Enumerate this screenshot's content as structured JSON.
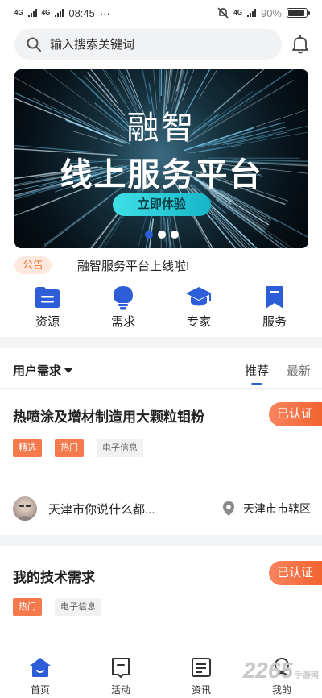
{
  "status_bar": {
    "time": "08:45",
    "dots": "···",
    "network_left": "4G",
    "network_right": "4G",
    "battery": "90%",
    "battery_level": 0.9
  },
  "search": {
    "placeholder": "输入搜索关键词"
  },
  "banner": {
    "title_line1": "融智",
    "title_line2": "线上服务平台",
    "button_label": "立即体验",
    "page_count": 3,
    "active_index": 0
  },
  "notice": {
    "tag": "公告",
    "text": "融智服务平台上线啦!"
  },
  "quick_nav": [
    {
      "label": "资源",
      "icon": "folder-icon"
    },
    {
      "label": "需求",
      "icon": "lightbulb-icon"
    },
    {
      "label": "专家",
      "icon": "graduation-cap-icon"
    },
    {
      "label": "服务",
      "icon": "bookmark-icon"
    }
  ],
  "section": {
    "filter_label": "用户需求",
    "tabs": [
      {
        "label": "推荐",
        "active": true
      },
      {
        "label": "最新",
        "active": false
      }
    ]
  },
  "cards": [
    {
      "title": "热喷涂及增材制造用大颗粒钼粉",
      "badge": "已认证",
      "tags": [
        {
          "label": "精选",
          "style": "hot"
        },
        {
          "label": "热门",
          "style": "hot"
        },
        {
          "label": "电子信息",
          "style": "cat"
        }
      ],
      "user": "天津市你说什么都...",
      "location": "天津市市辖区"
    },
    {
      "title": "我的技术需求",
      "badge": "已认证",
      "tags": [
        {
          "label": "热门",
          "style": "hot"
        },
        {
          "label": "电子信息",
          "style": "cat"
        }
      ]
    }
  ],
  "bottom_nav": [
    {
      "label": "首页",
      "icon": "home-icon",
      "active": true
    },
    {
      "label": "活动",
      "icon": "flag-icon",
      "active": false
    },
    {
      "label": "资讯",
      "icon": "news-icon",
      "active": false
    },
    {
      "label": "我的",
      "icon": "user-icon",
      "active": false
    }
  ],
  "watermark": {
    "text": "2265",
    "sub": "手游网"
  },
  "colors": {
    "accent_blue": "#2d5ed8",
    "accent_orange": "#f2632f",
    "banner_button": "#3fe0e6"
  }
}
